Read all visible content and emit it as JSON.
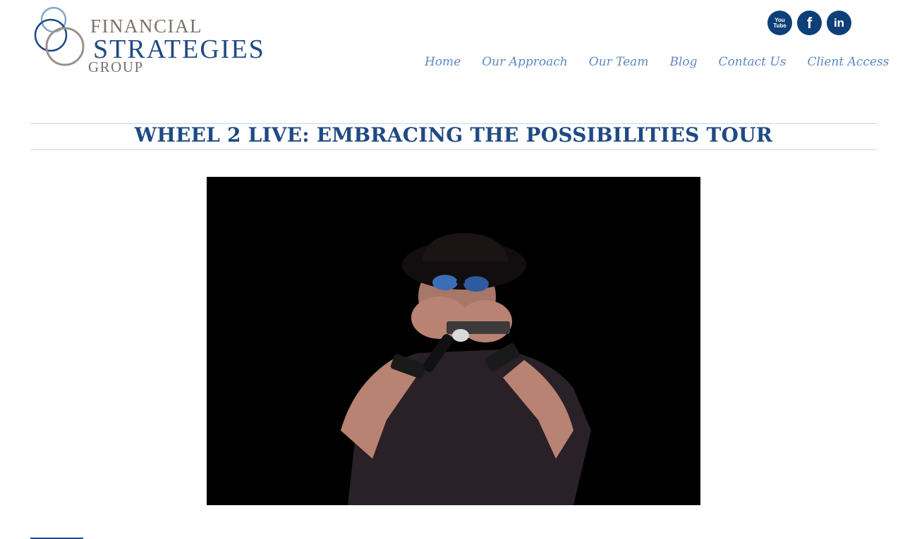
{
  "logo": {
    "line1": "FINANCIAL",
    "line2": "STRATEGIES",
    "line3": "GROUP"
  },
  "social": [
    {
      "name": "youtube-icon",
      "label": "You Tube"
    },
    {
      "name": "facebook-icon",
      "label": "f"
    },
    {
      "name": "linkedin-icon",
      "label": "in"
    }
  ],
  "nav": {
    "items": [
      {
        "label": "Home"
      },
      {
        "label": "Our Approach"
      },
      {
        "label": "Our Team"
      },
      {
        "label": "Blog"
      },
      {
        "label": "Contact Us"
      },
      {
        "label": "Client Access"
      }
    ]
  },
  "page": {
    "title": "WHEEL 2 LIVE: EMBRACING THE POSSIBILITIES TOUR"
  },
  "colors": {
    "brand_blue": "#1f4a84",
    "nav_blue": "#5c88c2",
    "logo_gray": "#7a716a",
    "social_bg": "#0f3f78"
  }
}
